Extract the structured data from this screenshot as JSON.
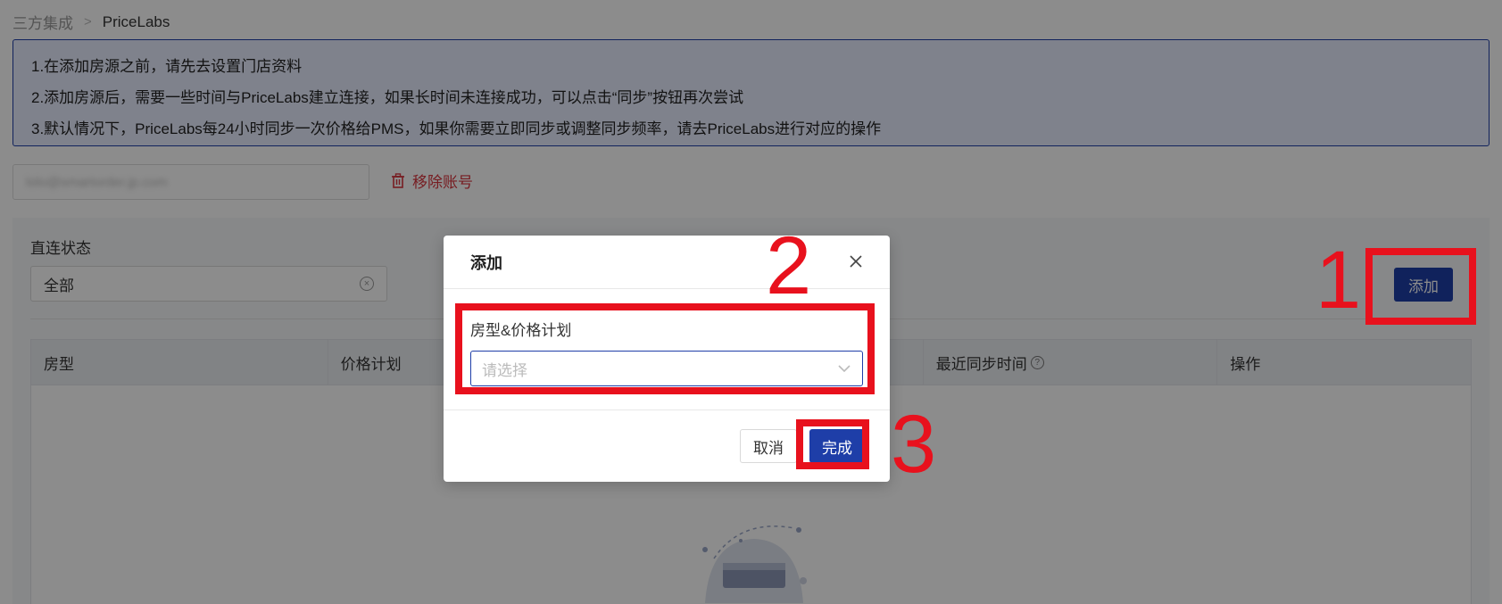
{
  "breadcrumb": {
    "parent": "三方集成",
    "separator": ">",
    "current": "PriceLabs"
  },
  "notice": {
    "lines": [
      "1.在添加房源之前，请先去设置门店资料",
      "2.添加房源后，需要一些时间与PriceLabs建立连接，如果长时间未连接成功，可以点击“同步”按钮再次尝试",
      "3.默认情况下，PriceLabs每24小时同步一次价格给PMS，如果你需要立即同步或调整同步频率，请去PriceLabs进行对应的操作"
    ]
  },
  "account": {
    "email": "lolo@smartorder.jp.com",
    "remove_label": "移除账号"
  },
  "filter": {
    "label": "直连状态",
    "value": "全部"
  },
  "toolbar": {
    "add_label": "添加"
  },
  "table": {
    "columns": [
      "房型",
      "价格计划",
      "",
      "最近同步时间",
      "操作"
    ]
  },
  "modal": {
    "title": "添加",
    "field_label": "房型&价格计划",
    "field_placeholder": "请选择",
    "cancel_label": "取消",
    "done_label": "完成"
  },
  "annotations": {
    "step1": "1",
    "step2": "2",
    "step3": "3",
    "color": "#e8111d"
  },
  "colors": {
    "primary": "#1e3ea8",
    "danger": "#d9363e",
    "notice_bg": "#e8edff"
  },
  "icons": {
    "remove": "trash-icon",
    "close": "close-icon",
    "dropdown": "chevron-down-icon",
    "clear": "clear-circle-icon",
    "help": "question-circle-icon",
    "empty": "empty-state-illustration"
  }
}
